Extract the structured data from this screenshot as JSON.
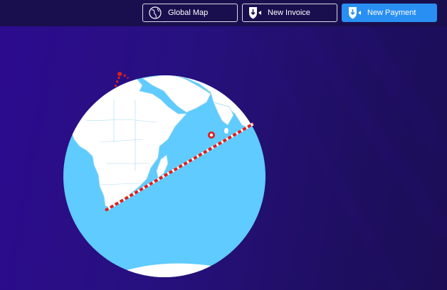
{
  "toolbar": {
    "global_map_label": "Global Map",
    "new_invoice_label": "New Invoice",
    "new_payment_label": "New Payment"
  },
  "colors": {
    "ocean": "#5fcbff",
    "land": "#ffffff",
    "route": "#d92020",
    "accent_button": "#2a8ff2",
    "header": "#1a0f4e"
  },
  "icons": {
    "globe": "globe-icon",
    "invoice": "shield-download-icon",
    "payment": "shield-download-icon",
    "marker": "location-pin-icon"
  }
}
